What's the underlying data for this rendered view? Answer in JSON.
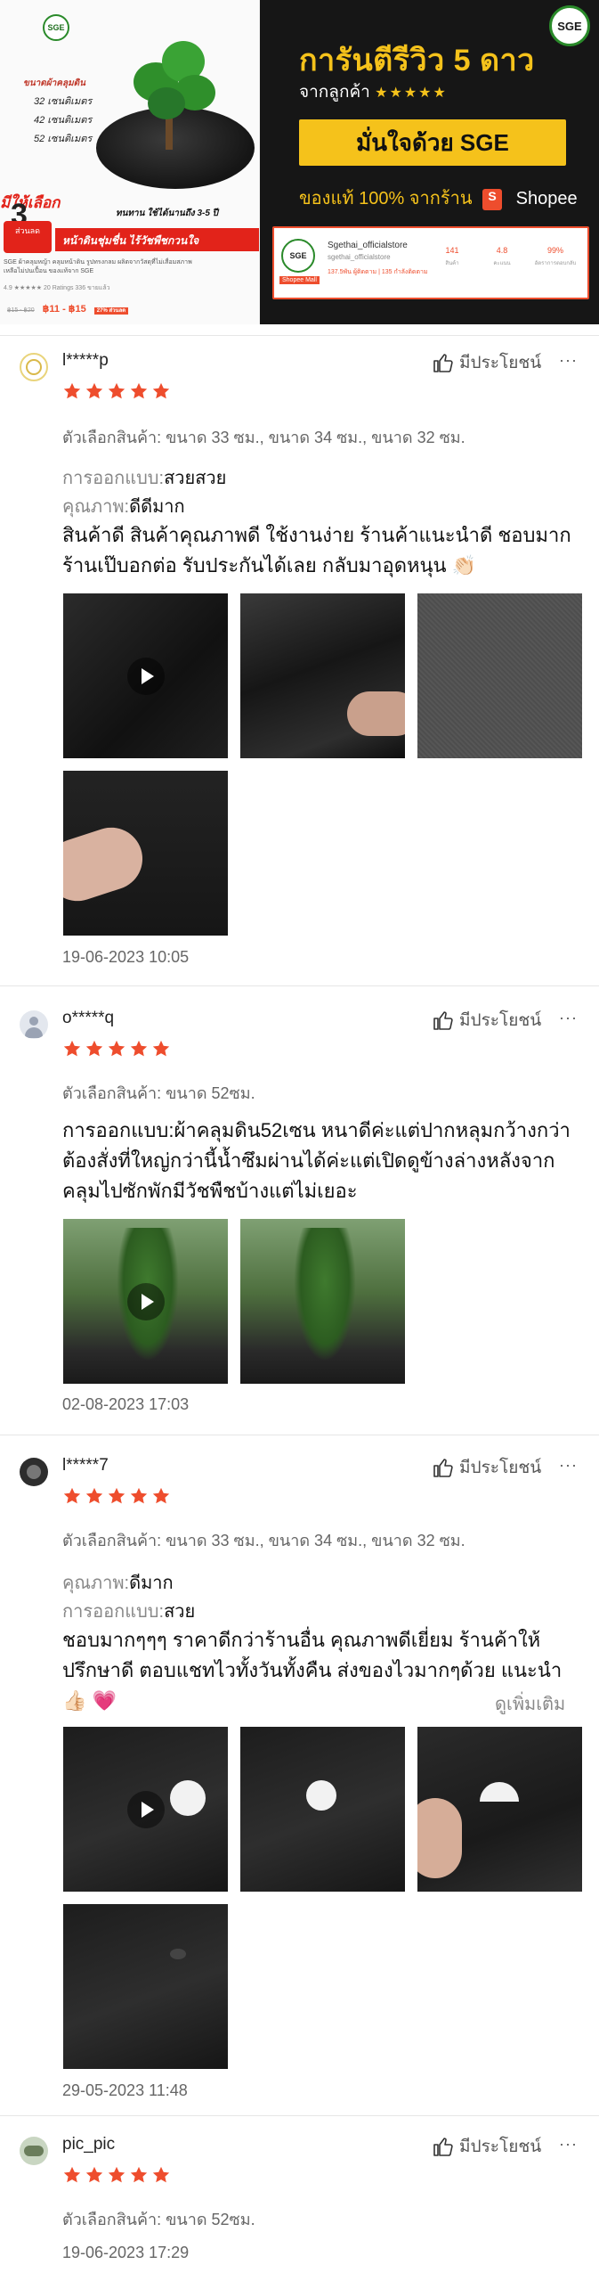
{
  "banner": {
    "left": {
      "logo": "SGE",
      "sizes_title": "ขนาดผ้าคลุมดิน",
      "sizes": [
        "32 เซนติเมตร",
        "42 เซนติเมตร",
        "52 เซนติเมตร"
      ],
      "promo_title": "มีให้เลือก",
      "promo_number": "3",
      "promo_badge": "ส่วนลด",
      "strip1": "ทนทาน ใช้ได้นานถึง 3-5 ปี",
      "strip2": "หน้าดินชุ่มชื่น ไร้วัชพืชกวนใจ",
      "info_line1": "SGE ผ้าคลุมหญ้า คลุมหน้าดิน รูปทรงกลม ผลิตจากวัสดุที่ไม่เสื่อมสภาพ",
      "info_line2": "เหลือไม่ปนเปื้อน ของแท้จาก SGE",
      "stats": "4.9 ★★★★★  20 Ratings  336 ขายแล้ว",
      "price_old": "฿15 - ฿20",
      "price": "฿11 - ฿15",
      "price_off": "27% ส่วนลด"
    },
    "right": {
      "logo": "SGE",
      "title": "การันตีรีวิว 5 ดาว",
      "subtitle": "จากลูกค้า",
      "subtitle_stars": "★★★★★",
      "button": "มั่นใจด้วย SGE",
      "line": "ของแท้ 100% จากร้าน",
      "shopee_icon": "S",
      "shopee": "Shopee",
      "card": {
        "avatar": "SGE",
        "preferred": "Shopee Mall",
        "name": "Sgethai_officialstore",
        "id": "sgethai_officialstore",
        "meta": "137.5พัน ผู้ติดตาม | 135 กำลังติดตาม",
        "kpis": [
          {
            "value": "141",
            "label": "สินค้า"
          },
          {
            "value": "4.8",
            "label": "คะแนน"
          },
          {
            "value": "99%",
            "label": "อัตราการตอบกลับ"
          }
        ]
      }
    }
  },
  "ui": {
    "helpful_label": "มีประโยชน์",
    "more_icon": "···",
    "variation_prefix": "ตัวเลือกสินค้า:",
    "design_label": "การออกแบบ:",
    "quality_label": "คุณภาพ:",
    "see_more": "ดูเพิ่มเติม"
  },
  "reviews": [
    {
      "username": "l*****p",
      "rating": 5,
      "variation": "ตัวเลือกสินค้า: ขนาด 33 ซม., ขนาด 34 ซม., ขนาด 32 ซม.",
      "design": "สวยสวย",
      "quality": "ดีดีมาก",
      "text_line1": "สินค้าดี สินค้าคุณภาพดี ใช้งานง่าย ร้านค้าแนะนำดี ชอบมาก",
      "text_line2": "ร้านเป๊บอกต่อ รับประกันได้เลย กลับมาอุดหนุน 👏🏻",
      "date": "19-06-2023 10:05"
    },
    {
      "username": "o*****q",
      "rating": 5,
      "variation": "ตัวเลือกสินค้า: ขนาด 52ซม.",
      "text_line1": "การออกแบบ:ผ้าคลุมดิน52เซน หนาดีค่ะแต่ปากหลุมกว้างกว่า",
      "text_line2": "ต้องสั่งที่ใหญ่กว่านี้น้ำซึมผ่านได้ค่ะแต่เปิดดูข้างล่างหลังจาก",
      "text_line3": "คลุมไปซักพักมีวัชพืชบ้างแต่ไม่เยอะ",
      "date": "02-08-2023 17:03"
    },
    {
      "username": "l*****7",
      "rating": 5,
      "variation": "ตัวเลือกสินค้า: ขนาด 33 ซม., ขนาด 34 ซม., ขนาด 32 ซม.",
      "quality": "ดีมาก",
      "design": "สวย",
      "text_line1": "ชอบมากๆๆๆ ราคาดีกว่าร้านอื่น คุณภาพดีเยี่ยม ร้านค้าให้",
      "text_line2": "ปรึกษาดี ตอบแชทไวทั้งวันทั้งคืน ส่งของไวมากๆด้วย แนะนำ",
      "text_line3": "👍🏻 💗",
      "date": "29-05-2023 11:48"
    },
    {
      "username": "pic_pic",
      "rating": 5,
      "variation": "ตัวเลือกสินค้า: ขนาด 52ซม.",
      "date": "19-06-2023 17:29"
    }
  ],
  "colors": {
    "star": "#ee4d2d",
    "shopee": "#ee4d2d",
    "gold": "#f5c21b",
    "banner_dark": "#161616"
  }
}
